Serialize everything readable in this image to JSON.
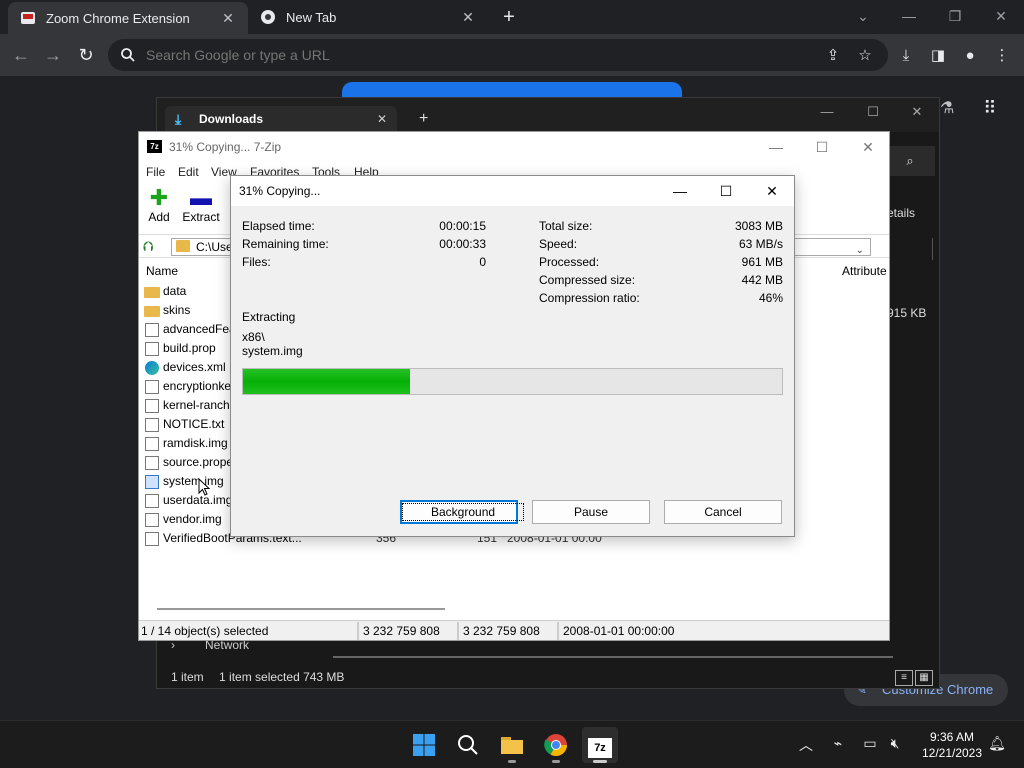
{
  "chrome": {
    "tabs": [
      {
        "title": "Zoom Chrome Extension"
      },
      {
        "title": "New Tab"
      }
    ],
    "omnibox_placeholder": "Search Google or type a URL",
    "customize_label": "Customize Chrome"
  },
  "explorer": {
    "tab_title": "Downloads",
    "details_label": "etails",
    "row_size": "915 KB",
    "nav_network": "Network",
    "status": {
      "items": "1 item",
      "selected": "1 item selected  743 MB"
    }
  },
  "sevenzip": {
    "title": "31% Copying... 7-Zip",
    "menu": [
      "File",
      "Edit",
      "View",
      "Favorites",
      "Tools",
      "Help"
    ],
    "tools": {
      "add": "Add",
      "extract": "Extract"
    },
    "path": "C:\\Use",
    "columns": {
      "name": "Name",
      "attributes": "Attribute"
    },
    "files": [
      {
        "name": "data",
        "icon": "folder"
      },
      {
        "name": "skins",
        "icon": "folder"
      },
      {
        "name": "advancedFea",
        "icon": "doc"
      },
      {
        "name": "build.prop",
        "icon": "doc"
      },
      {
        "name": "devices.xml",
        "icon": "edge"
      },
      {
        "name": "encryptionke",
        "icon": "doc"
      },
      {
        "name": "kernel-ranch",
        "icon": "doc"
      },
      {
        "name": "NOTICE.txt",
        "icon": "doc"
      },
      {
        "name": "ramdisk.img",
        "icon": "doc"
      },
      {
        "name": "source.prope",
        "icon": "doc"
      },
      {
        "name": "system.img",
        "icon": "sel"
      },
      {
        "name": "userdata.img",
        "icon": "doc"
      },
      {
        "name": "vendor.img",
        "icon": "doc"
      },
      {
        "name": "VerifiedBootParams.text...",
        "icon": "doc",
        "size": "356",
        "packed": "151",
        "modified": "2008-01-01 00:00"
      }
    ],
    "status": {
      "selection": "1 / 14 object(s) selected",
      "size": "3 232 759 808",
      "packed": "3 232 759 808",
      "modified": "2008-01-01 00:00:00"
    }
  },
  "dialog": {
    "title": "31% Copying...",
    "left": [
      {
        "label": "Elapsed time:",
        "value": "00:00:15"
      },
      {
        "label": "Remaining time:",
        "value": "00:00:33"
      },
      {
        "label": "Files:",
        "value": "0"
      }
    ],
    "right": [
      {
        "label": "Total size:",
        "value": "3083 MB"
      },
      {
        "label": "Speed:",
        "value": "63 MB/s"
      },
      {
        "label": "Processed:",
        "value": "961 MB"
      },
      {
        "label": "Compressed size:",
        "value": "442 MB"
      },
      {
        "label": "Compression ratio:",
        "value": "46%"
      }
    ],
    "operation": "Extracting",
    "folder": "x86\\",
    "file": "system.img",
    "progress_fraction": 0.31,
    "buttons": {
      "background": "Background",
      "pause": "Pause",
      "cancel": "Cancel"
    }
  },
  "taskbar": {
    "time": "9:36 AM",
    "date": "12/21/2023"
  }
}
